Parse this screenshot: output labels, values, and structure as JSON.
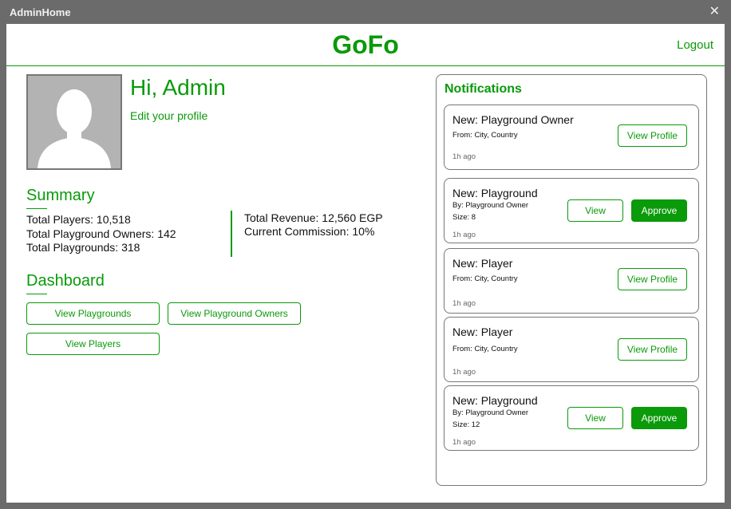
{
  "window": {
    "title": "AdminHome",
    "close_glyph": "✕"
  },
  "header": {
    "logo": "GoFo",
    "logout_label": "Logout"
  },
  "profile": {
    "greeting": "Hi, Admin",
    "edit_link": "Edit your profile",
    "avatar_icon": "user-silhouette-icon"
  },
  "summary": {
    "title": "Summary",
    "total_players": "Total Players: 10,518",
    "total_owners": "Total Playground Owners: 142",
    "total_playgrounds": "Total Playgrounds: 318",
    "total_revenue": "Total Revenue: 12,560 EGP",
    "commission": "Current Commission: 10%"
  },
  "dashboard": {
    "title": "Dashboard",
    "view_playgrounds": "View Playgrounds",
    "view_owners": "View Playground Owners",
    "view_players": "View Players"
  },
  "notifications": {
    "title": "Notifications",
    "items": [
      {
        "title": "New: Playground Owner",
        "line1": "From: City, Country",
        "line2": "",
        "time": "1h ago",
        "primary_label": "View Profile",
        "approve_label": ""
      },
      {
        "title": "New: Playground",
        "line1": "By: Playground Owner",
        "line2": "Size: 8",
        "time": "1h ago",
        "primary_label": "View",
        "approve_label": "Approve"
      },
      {
        "title": "New: Player",
        "line1": "From: City, Country",
        "line2": "",
        "time": "1h ago",
        "primary_label": "View Profile",
        "approve_label": ""
      },
      {
        "title": "New: Player",
        "line1": "From: City, Country",
        "line2": "",
        "time": "1h ago",
        "primary_label": "View Profile",
        "approve_label": ""
      },
      {
        "title": "New: Playground",
        "line1": "By: Playground Owner",
        "line2": "Size: 12",
        "time": "1h ago",
        "primary_label": "View",
        "approve_label": "Approve"
      }
    ]
  },
  "colors": {
    "brand": "#0a9a0a",
    "titlebar": "#6b6b6b",
    "border": "#777777"
  }
}
